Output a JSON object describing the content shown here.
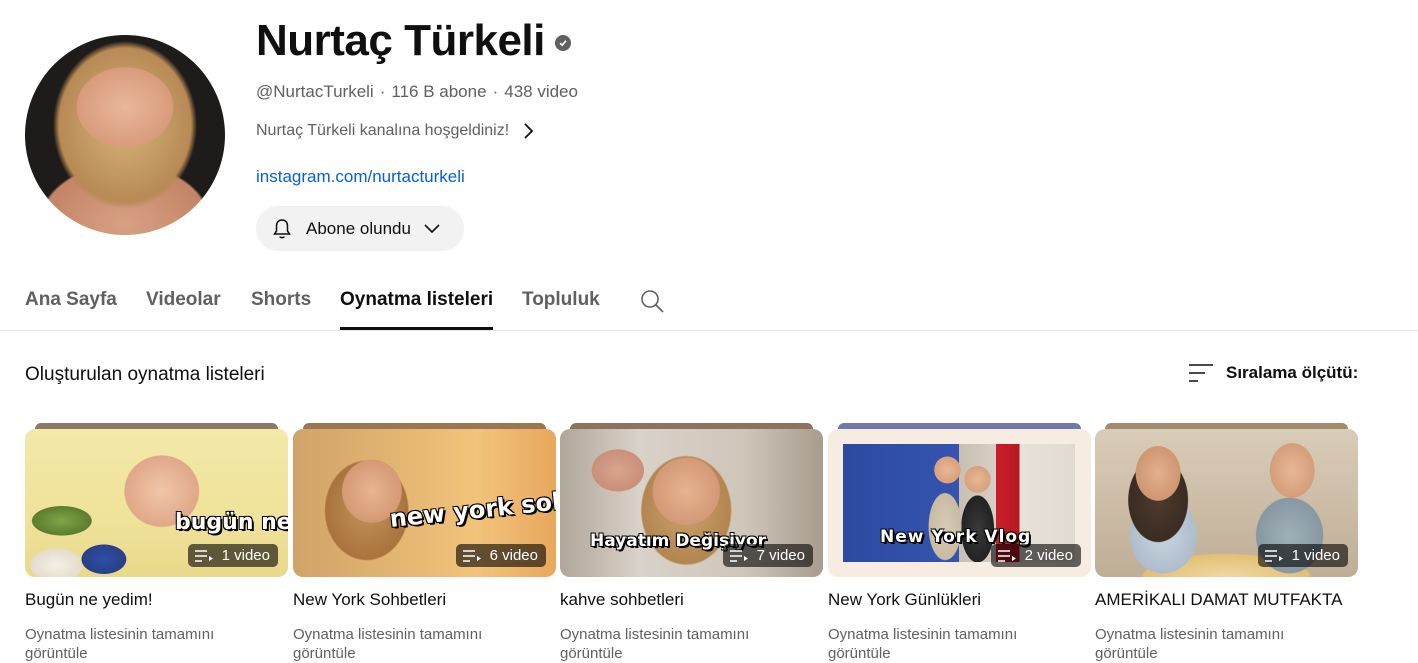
{
  "channel": {
    "name": "Nurtaç Türkeli",
    "handle": "@NurtacTurkeli",
    "subscribers": "116 B abone",
    "video_count": "438 video",
    "separator": "·",
    "description": "Nurtaç Türkeli kanalına hoşgeldiniz!",
    "link": "instagram.com/nurtacturkeli",
    "subscribe_label": "Abone olundu"
  },
  "tabs": [
    {
      "label": "Ana Sayfa",
      "active": false
    },
    {
      "label": "Videolar",
      "active": false
    },
    {
      "label": "Shorts",
      "active": false
    },
    {
      "label": "Oynatma listeleri",
      "active": true
    },
    {
      "label": "Topluluk",
      "active": false
    }
  ],
  "section": {
    "title": "Oluşturulan oynatma listeleri",
    "sort_label": "Sıralama ölçütü:"
  },
  "playlists": [
    {
      "title": "Bugün ne yedim!",
      "count": "1 video",
      "link": "Oynatma listesinin tamamını görüntüle",
      "overlay": "bugün ne yedim?"
    },
    {
      "title": "New York Sohbetleri",
      "count": "6 video",
      "link": "Oynatma listesinin tamamını görüntüle",
      "overlay": "new york sohbetleri"
    },
    {
      "title": "kahve sohbetleri",
      "count": "7 video",
      "link": "Oynatma listesinin tamamını görüntüle",
      "overlay": "Hayatım Değişiyor"
    },
    {
      "title": "New York Günlükleri",
      "count": "2 video",
      "link": "Oynatma listesinin tamamını görüntüle",
      "overlay": "New York Vlog"
    },
    {
      "title": "AMERİKALI DAMAT MUTFAKTA",
      "count": "1 video",
      "link": "Oynatma listesinin tamamını görüntüle",
      "overlay": ""
    }
  ],
  "icons": {
    "verified": "verified-check-icon",
    "chevron": "chevron-right-icon",
    "bell": "bell-icon",
    "dropdown": "chevron-down-icon",
    "search": "search-icon",
    "sort": "sort-icon",
    "playlist": "playlist-icon"
  },
  "colors": {
    "link": "#065fd4",
    "muted": "#606060",
    "button_bg": "#f2f2f2"
  }
}
